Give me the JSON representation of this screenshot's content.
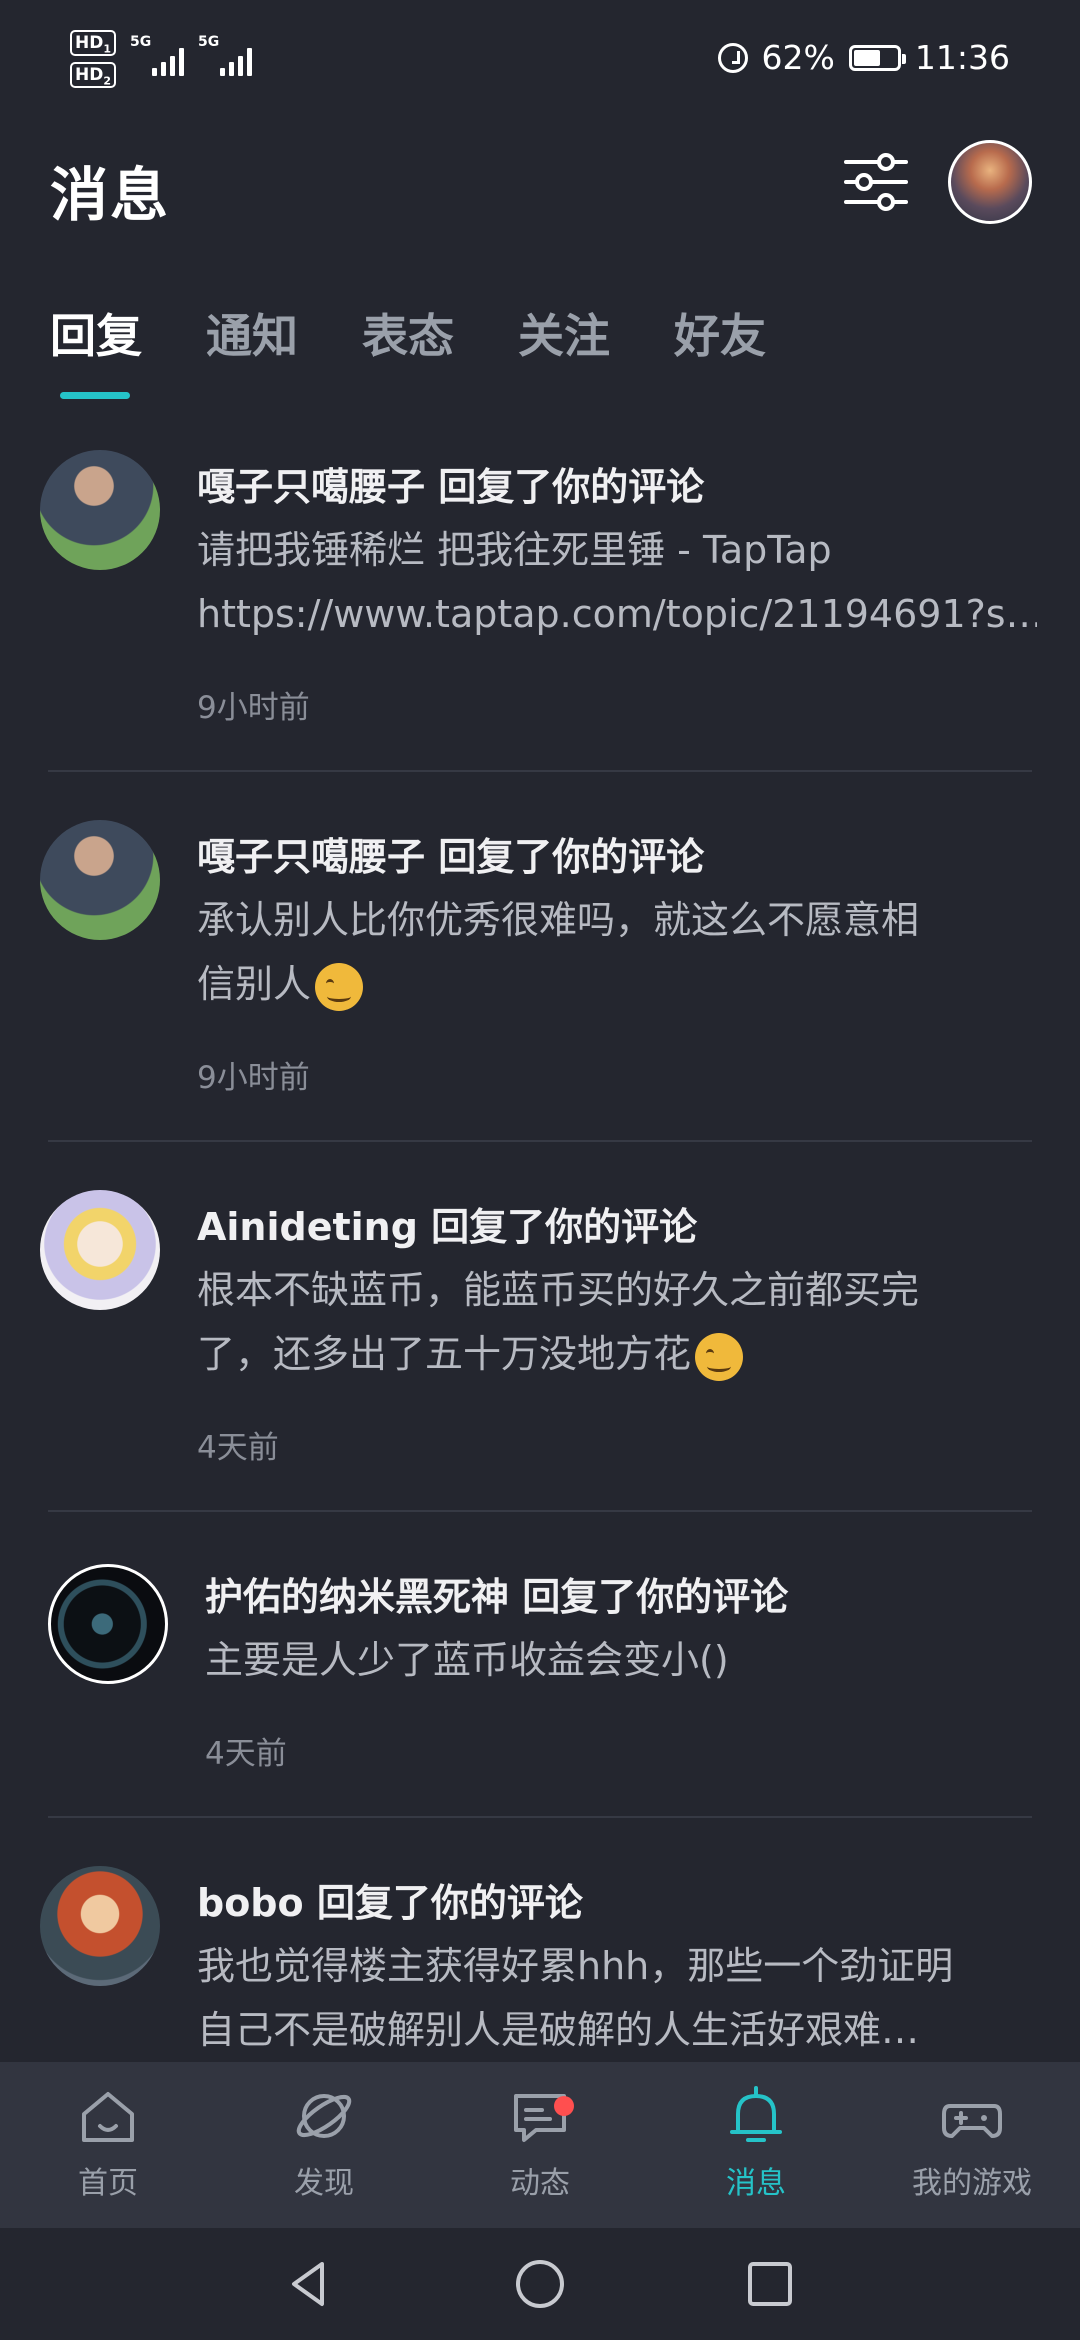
{
  "status_bar": {
    "hd1": "HD",
    "hd1_sub": "1",
    "hd2": "HD",
    "hd2_sub": "2",
    "net1": "5G",
    "net2": "5G",
    "battery_percent": "62%",
    "battery_level": 0.62,
    "time": "11:36"
  },
  "header": {
    "title": "消息"
  },
  "tabs": [
    {
      "label": "回复",
      "active": true
    },
    {
      "label": "通知",
      "active": false
    },
    {
      "label": "表态",
      "active": false
    },
    {
      "label": "关注",
      "active": false
    },
    {
      "label": "好友",
      "active": false
    }
  ],
  "messages": [
    {
      "user": "嘎子只噶腰子",
      "action": "回复了你的评论",
      "line1": "请把我锤稀烂 把我往死里锤 - TapTap",
      "line2": "https://www.taptap.com/topic/21194691?s…",
      "time": "9小时前"
    },
    {
      "user": "嘎子只噶腰子",
      "action": "回复了你的评论",
      "line1": "承认别人比你优秀很难吗，就这么不愿意相",
      "line2": "信别人",
      "emoji": "sweat-smile-emoji",
      "time": "9小时前"
    },
    {
      "user": "Ainideting",
      "action": "回复了你的评论",
      "line1": "根本不缺蓝币，能蓝币买的好久之前都买完",
      "line2": "了，还多出了五十万没地方花",
      "emoji": "smirk-emoji",
      "time": "4天前"
    },
    {
      "user": "护佑的纳米黑死神",
      "action": "回复了你的评论",
      "line1": "主要是人少了蓝币收益会变小()",
      "time": "4天前"
    },
    {
      "user": "bobo",
      "action": "回复了你的评论",
      "line1": "我也觉得楼主获得好累hhh，那些一个劲证明",
      "line2": "自己不是破解别人是破解的人生活好艰难…"
    }
  ],
  "bottom_nav": [
    {
      "label": "首页",
      "icon": "home-icon"
    },
    {
      "label": "发现",
      "icon": "planet-icon"
    },
    {
      "label": "动态",
      "icon": "chat-icon",
      "badge": true
    },
    {
      "label": "消息",
      "icon": "bell-icon",
      "active": true
    },
    {
      "label": "我的游戏",
      "icon": "gamepad-icon"
    }
  ],
  "colors": {
    "background": "#24262f",
    "accent": "#25c3c8",
    "nav_bg": "#323540",
    "badge": "#ff4f4f"
  }
}
